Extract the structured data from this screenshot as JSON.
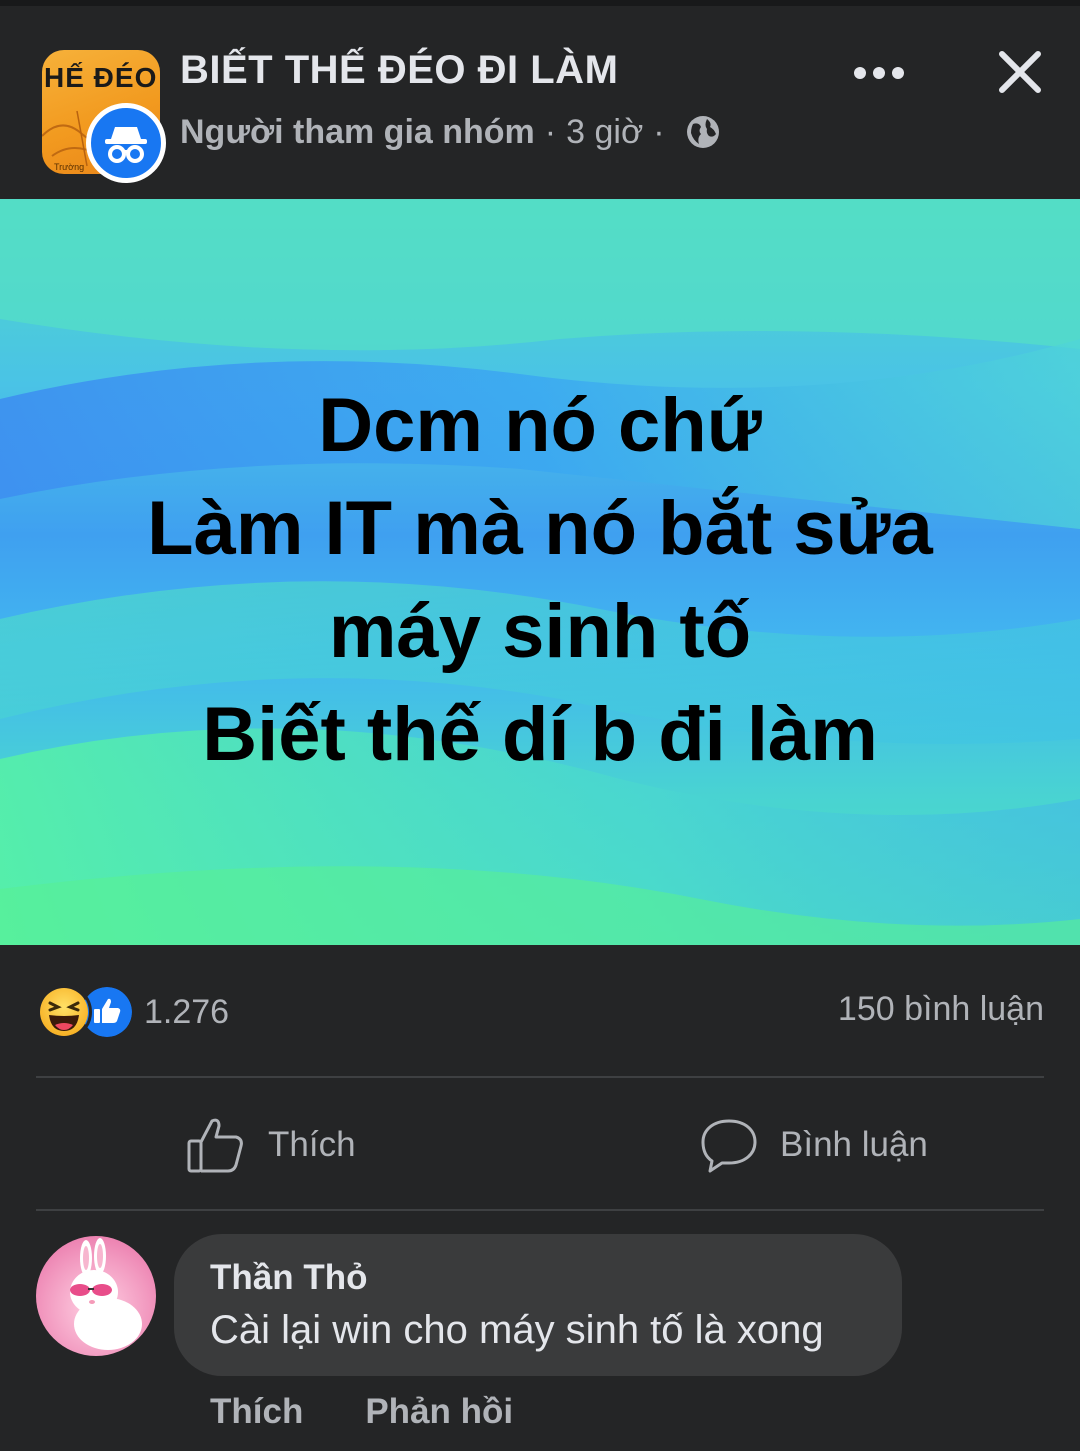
{
  "header": {
    "group_avatar_text": "HẾ ĐÉO Đ",
    "group_avatar_small": "Trường",
    "group_name": "BIẾT THẾ ĐÉO ĐI LÀM",
    "author": "Người tham gia nhóm",
    "separator": "·",
    "time": "3 giờ",
    "privacy_icon": "globe-icon",
    "more_icon": "more-icon",
    "close_icon": "close-icon",
    "anon_icon": "incognito-icon"
  },
  "post": {
    "lines": [
      "Dcm nó chứ",
      "Làm IT mà nó bắt sửa",
      "máy sinh tố",
      "Biết thế dí b đi làm"
    ],
    "background_colors": [
      "#4fd8c8",
      "#3fa0f0",
      "#4ce6b8"
    ]
  },
  "summary": {
    "reaction_icons": [
      "haha-icon",
      "like-icon"
    ],
    "reaction_count": "1.276",
    "comment_count": "150 bình luận"
  },
  "actions": {
    "like_label": "Thích",
    "comment_label": "Bình luận"
  },
  "comment": {
    "author": "Thần Thỏ",
    "text": "Cài lại win cho máy sinh tố là xong",
    "like_label": "Thích",
    "reply_label": "Phản hồi"
  },
  "colors": {
    "background": "#242526",
    "text_primary": "#e4e6eb",
    "text_secondary": "#b0b3b8",
    "bubble": "#3a3b3c",
    "accent": "#1877f2"
  }
}
